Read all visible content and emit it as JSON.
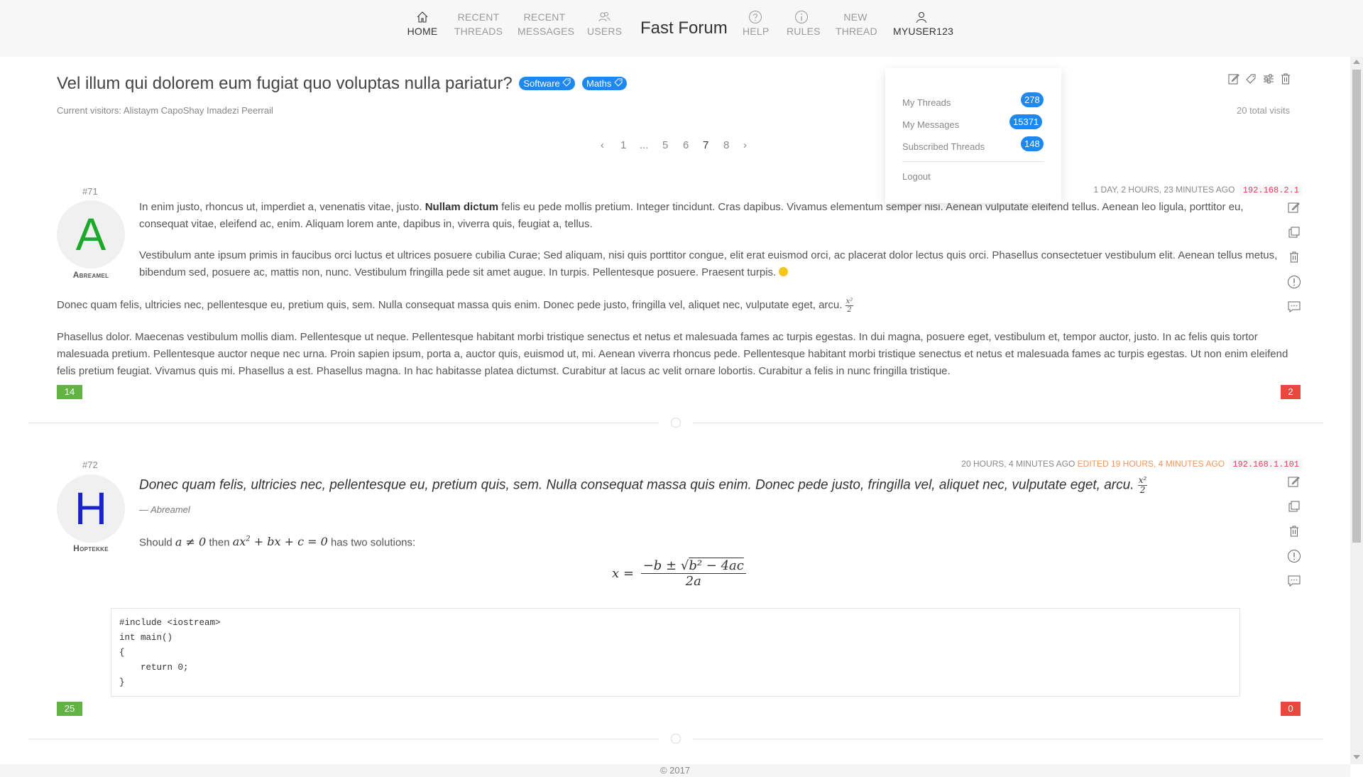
{
  "nav": {
    "home": "HOME",
    "recent_threads_1": "RECENT",
    "recent_threads_2": "THREADS",
    "recent_messages_1": "RECENT",
    "recent_messages_2": "MESSAGES",
    "users": "USERS",
    "brand": "Fast Forum",
    "help": "HELP",
    "rules": "RULES",
    "new_thread_1": "NEW",
    "new_thread_2": "THREAD",
    "user": "MYUSER123"
  },
  "thread": {
    "title": "Vel illum qui dolorem eum fugiat quo voluptas nulla pariatur?",
    "tags": [
      "Software",
      "Maths"
    ],
    "visitors": "Current visitors: Alistaym CapoShay Imadezi Peerrail",
    "total_visits": "20 total visits"
  },
  "pagination": {
    "first": "1",
    "ellipsis": "...",
    "pages": [
      "5",
      "6",
      "7",
      "8"
    ],
    "current": "7"
  },
  "user_menu": {
    "items": [
      {
        "label": "My Threads",
        "count": "278"
      },
      {
        "label": "My Messages",
        "count": "15371"
      },
      {
        "label": "Subscribed Threads",
        "count": "148"
      }
    ],
    "logout": "Logout"
  },
  "posts": [
    {
      "number": "#71",
      "avatar_letter": "A",
      "avatar_color": "#1ca828",
      "author": "Abreamel",
      "time": "1 DAY, 2 HOURS, 23 MINUTES AGO",
      "ip": "192.168.2.1",
      "p1_pre": "In enim justo, rhoncus ut, imperdiet a, venenatis vitae, justo. ",
      "p1_bold": "Nullam dictum",
      "p1_post": " felis eu pede mollis pretium. Integer tincidunt. Cras dapibus. Vivamus elementum semper nisi. Aenean vulputate eleifend tellus. Aenean leo ligula, porttitor eu, consequat vitae, eleifend ac, enim. Aliquam lorem ante, dapibus in, viverra quis, feugiat a, tellus.",
      "p2": "Vestibulum ante ipsum primis in faucibus orci luctus et ultrices posuere cubilia Curae; Sed aliquam, nisi quis porttitor congue, elit erat euismod orci, ac placerat dolor lectus quis orci. Phasellus consectetuer vestibulum elit. Aenean tellus metus, bibendum sed, posuere ac, mattis non, nunc. Vestibulum fringilla pede sit amet augue. In turpis. Pellentesque posuere. Praesent turpis.",
      "p3": "Donec quam felis, ultricies nec, pellentesque eu, pretium quis, sem. Nulla consequat massa quis enim. Donec pede justo, fringilla vel, aliquet nec, vulputate eget, arcu.",
      "p4": "Phasellus dolor. Maecenas vestibulum mollis diam. Pellentesque ut neque. Pellentesque habitant morbi tristique senectus et netus et malesuada fames ac turpis egestas. In dui magna, posuere eget, vestibulum et, tempor auctor, justo. In ac felis quis tortor malesuada pretium. Pellentesque auctor neque nec urna. Proin sapien ipsum, porta a, auctor quis, euismod ut, mi. Aenean viverra rhoncus pede. Pellentesque habitant morbi tristique senectus et netus et malesuada fames ac turpis egestas. Ut non enim eleifend felis pretium feugiat. Vivamus quis mi. Phasellus a est. Phasellus magna. In hac habitasse platea dictumst. Curabitur at lacus ac velit ornare lobortis. Curabitur a felis in nunc fringilla tristique.",
      "upvotes": "14",
      "downvotes": "2"
    },
    {
      "number": "#72",
      "avatar_letter": "H",
      "avatar_color": "#1a22cc",
      "author": "Hoptekke",
      "time": "20 HOURS, 4 MINUTES AGO",
      "edited": "EDITED 19 HOURS, 4 MINUTES AGO",
      "ip": "192.168.1.101",
      "quote": "Donec quam felis, ultricies nec, pellentesque eu, pretium quis, sem. Nulla consequat massa quis enim. Donec pede justo, fringilla vel, aliquet nec, vulputate eget, arcu.",
      "quote_author": "— Abreamel",
      "text_pre": "Should ",
      "text_mid": " then ",
      "text_post": " has two solutions:",
      "code": "#include <iostream>\nint main()\n{\n    return 0;\n}",
      "upvotes": "25",
      "downvotes": "0"
    }
  ],
  "footer": "© 2017"
}
